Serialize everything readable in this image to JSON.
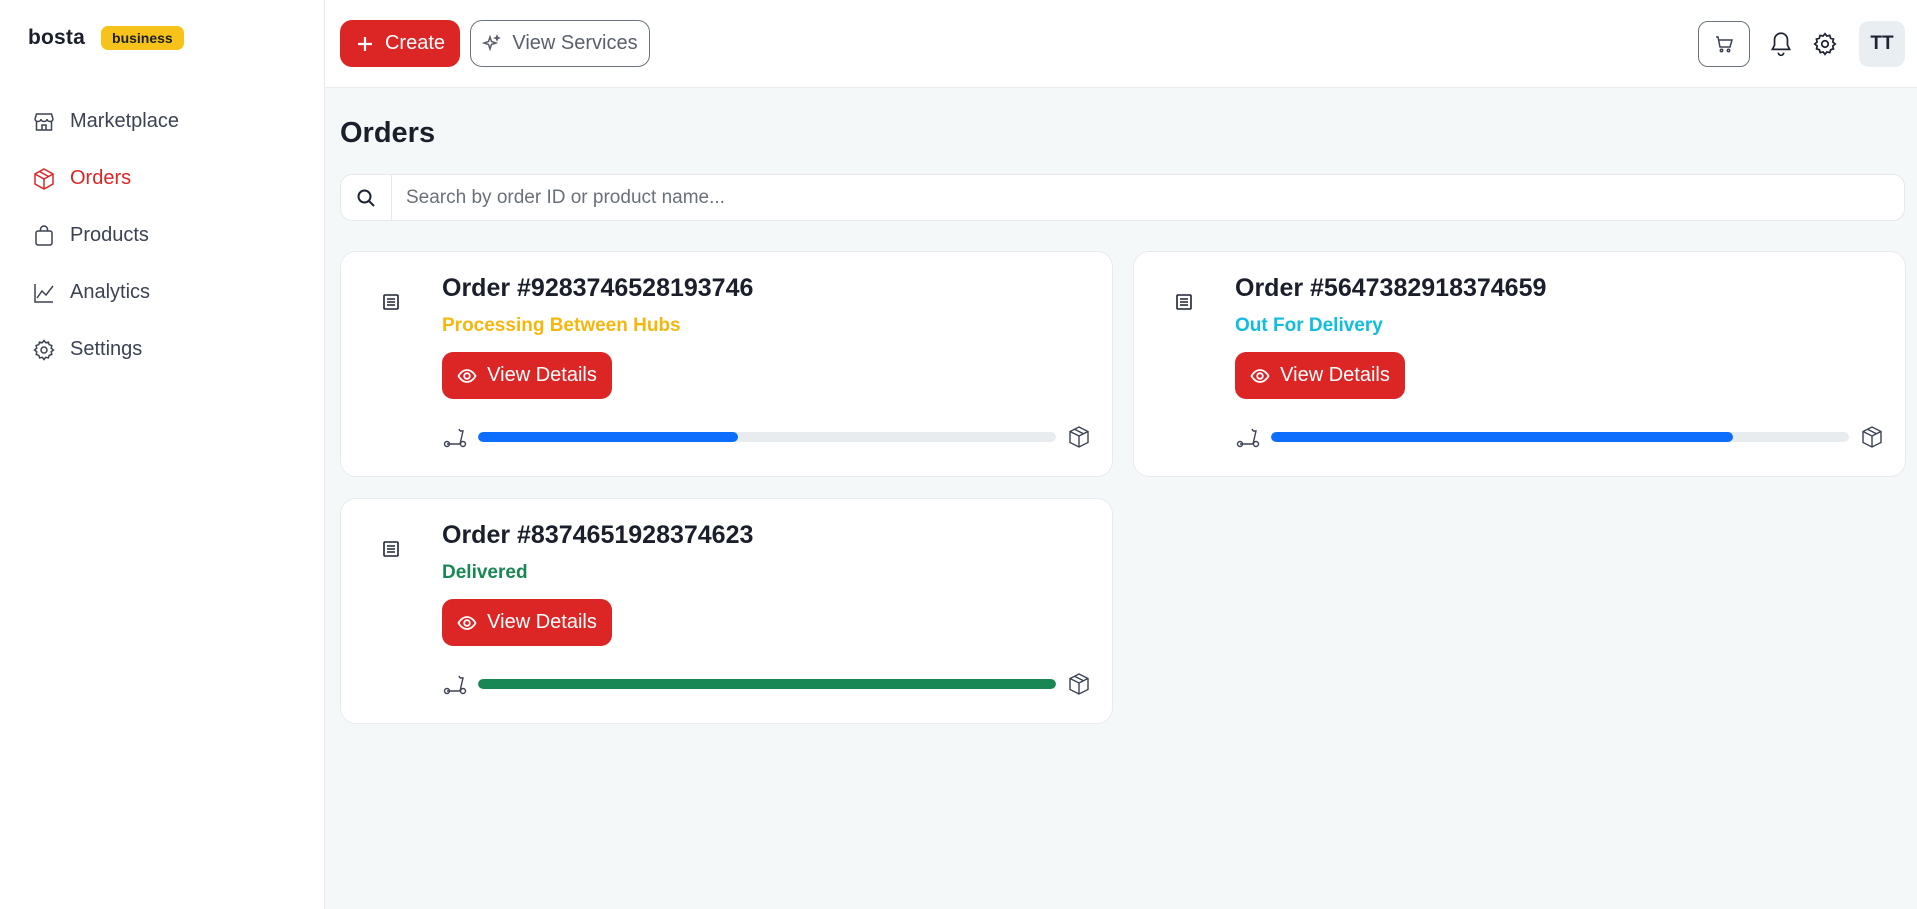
{
  "brand": {
    "name": "bosta",
    "badge": "business"
  },
  "nav": [
    {
      "label": "Marketplace",
      "icon": "store-icon",
      "active": false
    },
    {
      "label": "Orders",
      "icon": "box-icon",
      "active": true
    },
    {
      "label": "Products",
      "icon": "bag-icon",
      "active": false
    },
    {
      "label": "Analytics",
      "icon": "chart-line-icon",
      "active": false
    },
    {
      "label": "Settings",
      "icon": "gear-icon",
      "active": false
    }
  ],
  "topbar": {
    "create_label": "Create",
    "services_label": "View Services",
    "avatar_initials": "TT"
  },
  "page": {
    "title": "Orders"
  },
  "search": {
    "placeholder": "Search by order ID or product name...",
    "value": ""
  },
  "colors": {
    "accent": "#dc2626",
    "processing": "#f5b70e",
    "out_for_delivery": "#0fbde0",
    "delivered": "#198754",
    "progress_blue": "#0d6efd"
  },
  "orders": [
    {
      "title": "Order #9283746528193746",
      "status": "Processing Between Hubs",
      "status_color": "#f5b70e",
      "progress": 0.45,
      "bar_color": "#0d6efd",
      "view_label": "View Details"
    },
    {
      "title": "Order #5647382918374659",
      "status": "Out For Delivery",
      "status_color": "#0fbde0",
      "progress": 0.8,
      "bar_color": "#0d6efd",
      "view_label": "View Details"
    },
    {
      "title": "Order #8374651928374623",
      "status": "Delivered",
      "status_color": "#198754",
      "progress": 1.0,
      "bar_color": "#198754",
      "view_label": "View Details"
    }
  ]
}
